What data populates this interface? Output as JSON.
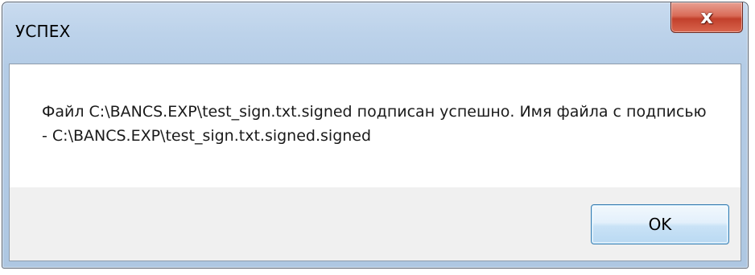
{
  "dialog": {
    "title": "УСПЕХ",
    "close_label": "x",
    "message": "Файл C:\\BANCS.EXP\\test_sign.txt.signed подписан успешно. Имя файла с подписью - C:\\BANCS.EXP\\test_sign.txt.signed.signed",
    "ok_label": "OK"
  },
  "colors": {
    "title_bar": "#bcd2ea",
    "close_button": "#d14b35",
    "ok_button_border": "#3c7fb1"
  }
}
